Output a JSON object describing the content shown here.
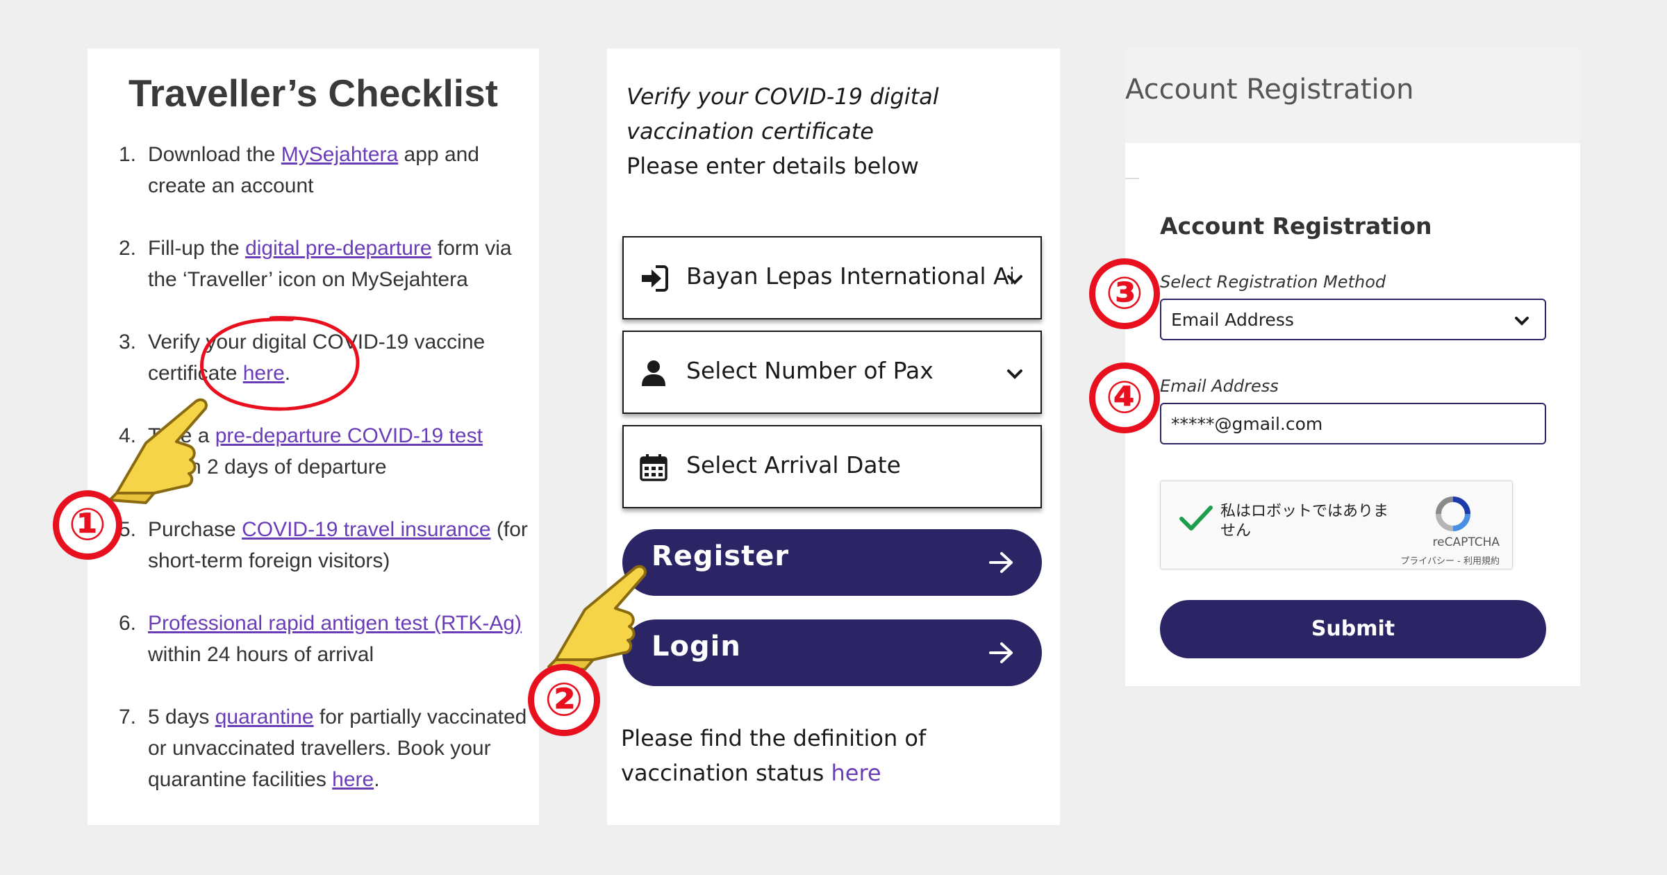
{
  "checklist": {
    "title": "Traveller’s Checklist",
    "items": [
      {
        "num": "1.",
        "pre": "Download the ",
        "link": "MySejahtera",
        "post": " app and create an account"
      },
      {
        "num": "2.",
        "pre": "Fill-up the ",
        "link": "digital pre-departure",
        "post": " form via the ‘Traveller’ icon on MySejahtera"
      },
      {
        "num": "3.",
        "pre": "Verify your digital COVID-19 vaccine certificate ",
        "link": "here",
        "post": "."
      },
      {
        "num": "4.",
        "pre": "Take a ",
        "link": "pre-departure COVID-19 test",
        "post": " within 2 days of departure"
      },
      {
        "num": "5.",
        "pre": "Purchase ",
        "link": "COVID-19 travel insurance",
        "post": " (for short-term foreign visitors)"
      },
      {
        "num": "6.",
        "pre": "",
        "link": "Professional rapid antigen test (RTK-Ag)",
        "post": " within 24 hours of arrival"
      },
      {
        "num": "7.",
        "pre": "5 days ",
        "link": "quarantine",
        "post": " for partially vaccinated or unvaccinated travellers. Book your quarantine facilities ",
        "link2": "here",
        "post2": "."
      }
    ]
  },
  "verify": {
    "heading_italic": "Verify your COVID-19 digital vaccination certificate",
    "heading_plain": "Please enter details below",
    "airport_select": "Bayan Lepas International Airp",
    "pax_select": "Select Number of Pax",
    "date_select": "Select Arrival Date",
    "register_label": "Register",
    "login_label": "Login",
    "footer_text": "Please find the definition of vaccination status ",
    "footer_link": "here"
  },
  "registration": {
    "page_title": "Account Registration",
    "card_title": "Account Registration",
    "method_label": "Select Registration Method",
    "method_value": "Email Address",
    "email_label": "Email Address",
    "email_value": "*****@gmail.com",
    "captcha_text": "私はロボットではありません",
    "captcha_brand": "reCAPTCHA",
    "captcha_terms": "プライバシー - 利用規約",
    "submit_label": "Submit"
  },
  "annotations": {
    "step1": "①",
    "step2": "②",
    "step3": "③",
    "step4": "④"
  },
  "colors": {
    "button_navy": "#2b2566",
    "link_purple": "#6a3db8",
    "annotation_red": "#e8101f",
    "pointer_yellow": "#f5d547"
  }
}
